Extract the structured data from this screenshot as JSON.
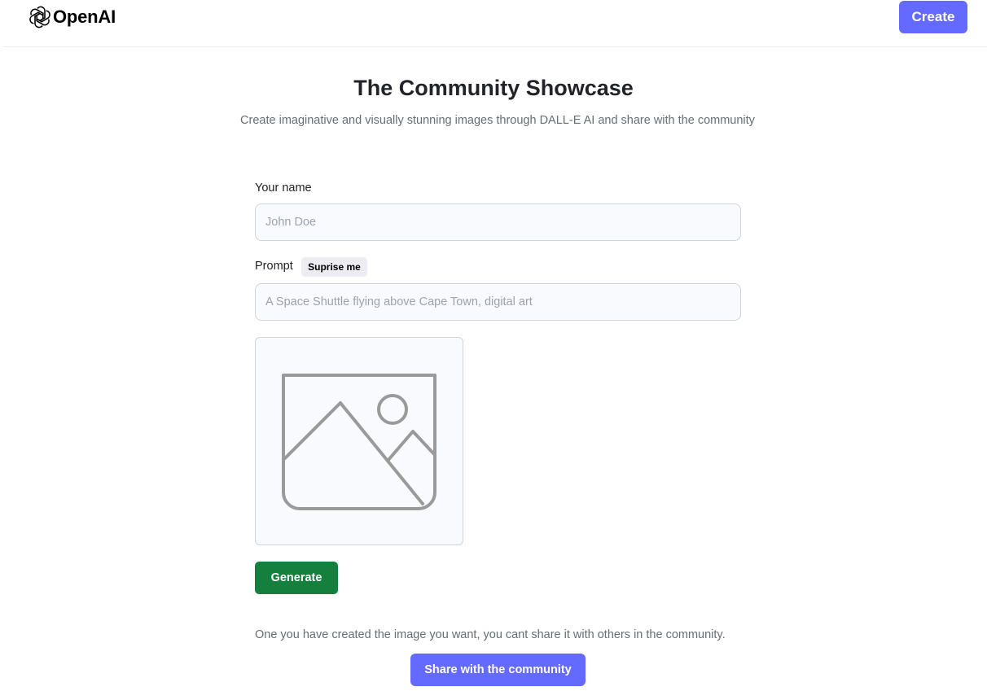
{
  "header": {
    "logo_text": "OpenAI",
    "create_label": "Create"
  },
  "main": {
    "title": "The Community Showcase",
    "subtitle": "Create imaginative and visually stunning images through DALL-E AI and share with the community"
  },
  "form": {
    "name_label": "Your name",
    "name_placeholder": "John Doe",
    "name_value": "",
    "prompt_label": "Prompt",
    "surprise_label": "Suprise me",
    "prompt_placeholder": "A Space Shuttle flying above Cape Town, digital art",
    "prompt_value": "",
    "preview_icon": "image-placeholder-icon",
    "generate_label": "Generate",
    "share_note": "One you have created the image you want, you cant share it with others in the community.",
    "share_label": "Share with the community"
  },
  "colors": {
    "accent": "#6469ff",
    "generate_green": "#15803d",
    "input_bg": "#f9fafe",
    "text_muted": "#666e75"
  }
}
